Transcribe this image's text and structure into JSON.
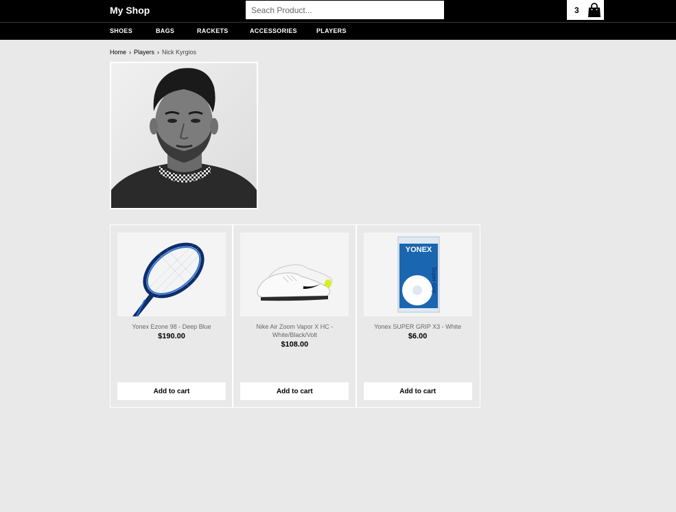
{
  "header": {
    "brand": "My Shop",
    "search_placeholder": "Seach Product...",
    "cart_count": "3",
    "cart_icon": "shopping-bag-icon"
  },
  "nav": {
    "items": [
      {
        "label": "SHOES"
      },
      {
        "label": "BAGS"
      },
      {
        "label": "RACKETS"
      },
      {
        "label": "ACCESSORIES"
      },
      {
        "label": "PLAYERS"
      }
    ]
  },
  "breadcrumb": {
    "items": [
      "Home",
      "Players",
      "Nick Kyrgios"
    ]
  },
  "products": [
    {
      "name": "Yonex Ezone 98 - Deep Blue",
      "price": "$190.00",
      "button": "Add to cart"
    },
    {
      "name": "Nike Air Zoom Vapor X HC - White/Black/Volt",
      "price": "$108.00",
      "button": "Add to cart"
    },
    {
      "name": "Yonex SUPER GRIP X3 - White",
      "price": "$6.00",
      "button": "Add to cart"
    }
  ],
  "product_images": [
    {
      "text": ""
    },
    {
      "text": ""
    },
    {
      "text": "YONEX",
      "vertical_text": "Super Grip"
    }
  ],
  "colors": {
    "header_bg": "#000000",
    "page_bg": "#e9e9e9",
    "button_bg": "#ffffff",
    "racket_blue": "#1b4f9c",
    "grip_blue": "#1b66b0"
  }
}
